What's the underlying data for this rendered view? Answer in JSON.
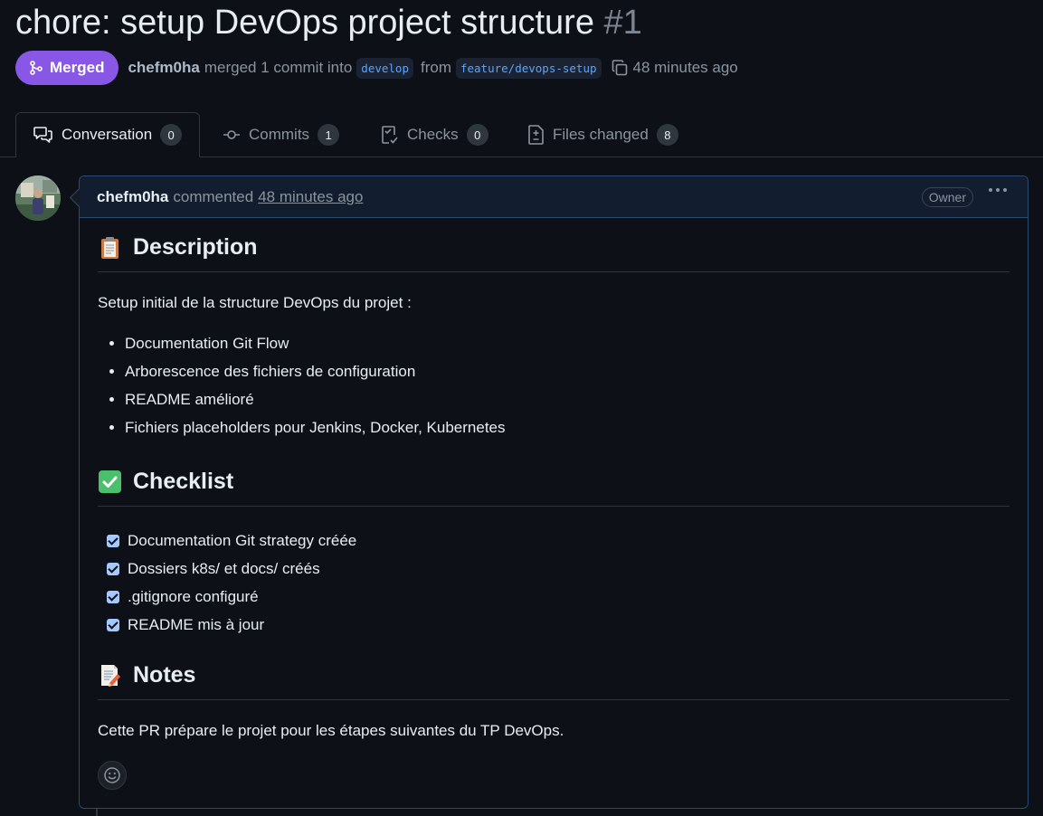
{
  "pr": {
    "title": "chore: setup DevOps project structure",
    "number": "#1"
  },
  "meta": {
    "status": "Merged",
    "author": "chefm0ha",
    "action": "merged 1 commit into",
    "base_branch": "develop",
    "from": "from",
    "head_branch": "feature/devops-setup",
    "time": "48 minutes ago"
  },
  "tabs": [
    {
      "label": "Conversation",
      "count": "0",
      "icon": "comment-discussion-icon"
    },
    {
      "label": "Commits",
      "count": "1",
      "icon": "git-commit-icon"
    },
    {
      "label": "Checks",
      "count": "0",
      "icon": "checklist-icon"
    },
    {
      "label": "Files changed",
      "count": "8",
      "icon": "file-diff-icon"
    }
  ],
  "comment": {
    "author": "chefm0ha",
    "action": "commented",
    "time": "48 minutes ago",
    "role": "Owner",
    "sections": {
      "description": {
        "heading": "Description",
        "emoji": "clipboard",
        "intro": "Setup initial de la structure DevOps du projet :",
        "items": [
          "Documentation Git Flow",
          "Arborescence des fichiers de configuration",
          "README amélioré",
          "Fichiers placeholders pour Jenkins, Docker, Kubernetes"
        ]
      },
      "checklist": {
        "heading": "Checklist",
        "emoji": "white-check-mark",
        "items": [
          {
            "label": "Documentation Git strategy créée",
            "checked": true
          },
          {
            "label": "Dossiers k8s/ et docs/ créés",
            "checked": true
          },
          {
            "label": ".gitignore configuré",
            "checked": true
          },
          {
            "label": "README mis à jour",
            "checked": true
          }
        ]
      },
      "notes": {
        "heading": "Notes",
        "emoji": "memo",
        "text": "Cette PR prépare le projet pour les étapes suivantes du TP DevOps."
      }
    }
  },
  "colors": {
    "background": "#0d1117",
    "merged": "#8957e5",
    "accent_border": "#2b4a73",
    "branch_text": "#58a6ff"
  }
}
